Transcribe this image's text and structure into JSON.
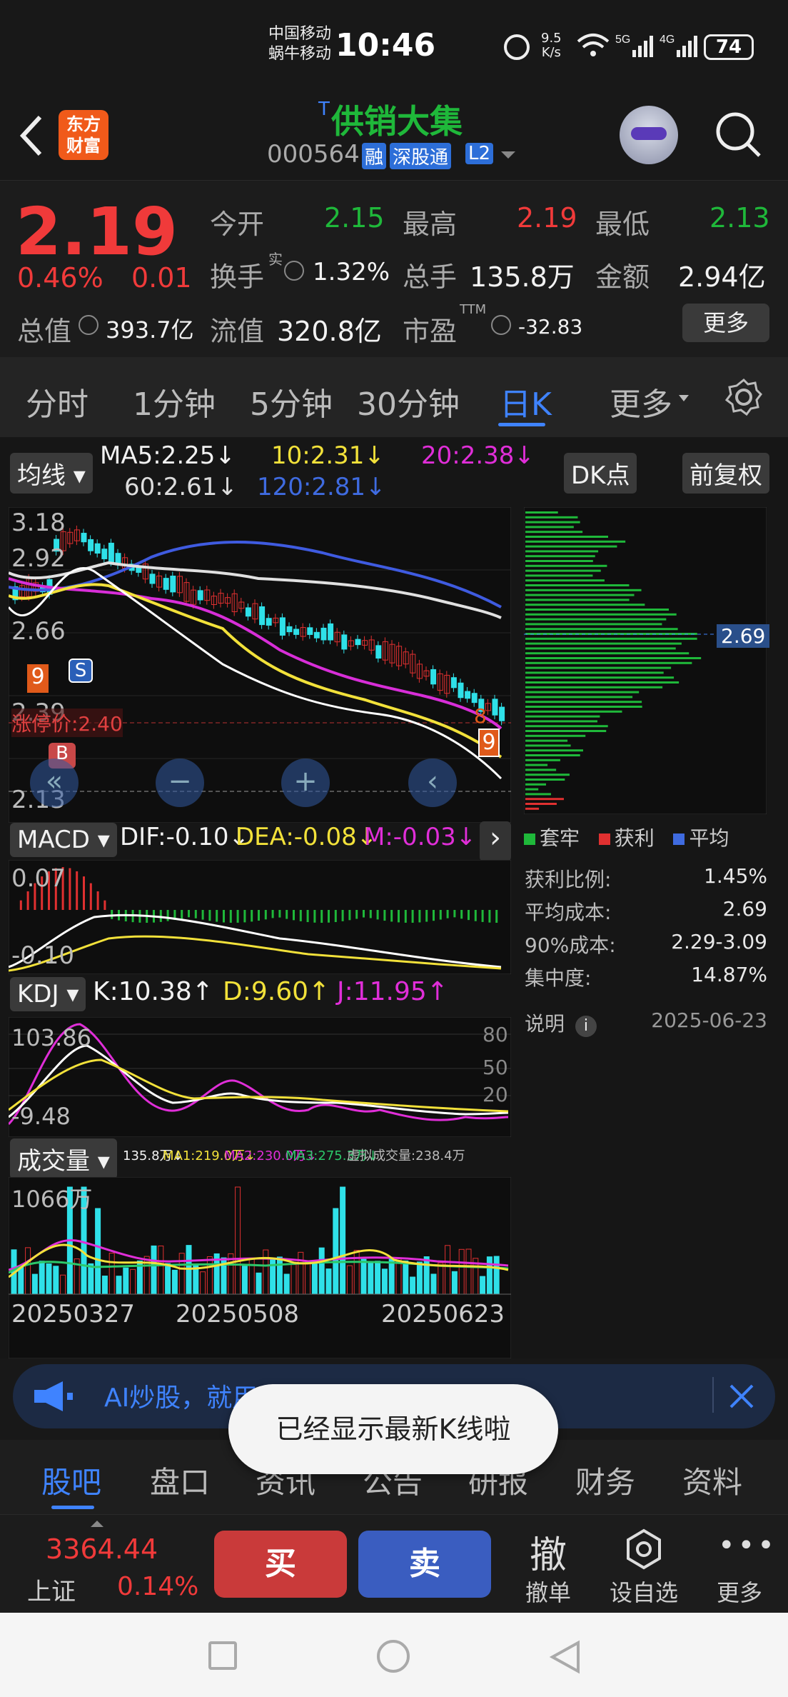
{
  "status": {
    "carrier1": "中国移动",
    "carrier2": "蜗牛移动",
    "time": "10:46",
    "speed_top": "9.5",
    "speed_unit": "K/s",
    "battery": "74"
  },
  "header": {
    "logo_line1": "东方",
    "logo_line2": "财富",
    "title_prefix": "T",
    "title": "供销大集",
    "code": "000564",
    "badge_rong": "融",
    "badge_sgt": "深股通",
    "badge_l2": "L2"
  },
  "quote": {
    "price": "2.19",
    "change_pct": "0.46%",
    "change": "0.01",
    "open_label": "今开",
    "open": "2.15",
    "high_label": "最高",
    "high": "2.19",
    "low_label": "最低",
    "low": "2.13",
    "turnover_label": "换手",
    "turnover_sup": "实",
    "turnover": "1.32%",
    "volume_label": "总手",
    "volume": "135.8万",
    "amount_label": "金额",
    "amount": "2.94亿",
    "mktcap_label": "总值",
    "mktcap": "393.7亿",
    "float_label": "流值",
    "float": "320.8亿",
    "pe_label": "市盈",
    "pe_sup": "TTM",
    "pe": "-32.83",
    "more": "更多"
  },
  "tabs": [
    "分时",
    "1分钟",
    "5分钟",
    "30分钟",
    "日K",
    "更多"
  ],
  "kline": {
    "ma_label": "均线",
    "ma5": "MA5:2.25↓",
    "ma10": "10:2.31↓",
    "ma20": "20:2.38↓",
    "ma60": "60:2.61↓",
    "ma120": "120:2.81↓",
    "dk_button": "DK点",
    "adj_button": "前复权",
    "y_top": "3.18",
    "y_2": "2.92",
    "y_3": "2.66",
    "y_4": "2.39",
    "y_bottom": "2.13",
    "limit_up": "涨停价:2.40",
    "b_marker": "B",
    "s_marker": "S",
    "nine_marker": "9",
    "eight_marker": "8",
    "cost_price": "2.69"
  },
  "macd": {
    "label": "MACD",
    "dif": "DIF:-0.10↓",
    "dea": "DEA:-0.08↓",
    "m": "M:-0.03↓",
    "y_top": "0.07",
    "y_bottom": "-0.10"
  },
  "kdj": {
    "label": "KDJ",
    "k": "K:10.38↑",
    "d": "D:9.60↑",
    "j": "J:11.95↑",
    "y_top": "103.86",
    "y_bottom": "-9.48",
    "r80": "80",
    "r50": "50",
    "r20": "20"
  },
  "volume": {
    "label": "成交量",
    "vol": "135.8万↓",
    "ma1": "MA1:219.0万↓",
    "ma2": "MA2:230.0万↓",
    "ma3": "MA3:275.3万↓",
    "virtual": "虚拟成交量:238.4万",
    "y_top": "1066万",
    "d1": "20250327",
    "d2": "20250508",
    "d3": "20250623"
  },
  "chips": {
    "legend_trapped": "套牢",
    "legend_profit": "获利",
    "legend_avg": "平均",
    "profit_ratio_label": "获利比例:",
    "profit_ratio": "1.45%",
    "avg_cost_label": "平均成本:",
    "avg_cost": "2.69",
    "cost90_label": "90%成本:",
    "cost90": "2.29-3.09",
    "concentration_label": "集中度:",
    "concentration": "14.87%",
    "note_label": "说明",
    "date": "2025-06-23"
  },
  "banner": {
    "text": "AI炒股，就用东方财富社区",
    "toast": "已经显示最新K线啦"
  },
  "footer_tabs": [
    "股吧",
    "盘口",
    "资讯",
    "公告",
    "研报",
    "财务",
    "资料"
  ],
  "bottom": {
    "index_value": "3364.44",
    "index_name": "上证",
    "index_change": "0.14%",
    "buy": "买",
    "sell": "卖",
    "cancel_icon_text": "撤",
    "cancel": "撤单",
    "watch": "设自选",
    "more": "更多"
  },
  "colors": {
    "up": "#f03a3a",
    "down": "#1fb83a",
    "accent": "#3f83ff",
    "buy_button": "#c93a3a",
    "sell_button": "#3a5dc0"
  }
}
